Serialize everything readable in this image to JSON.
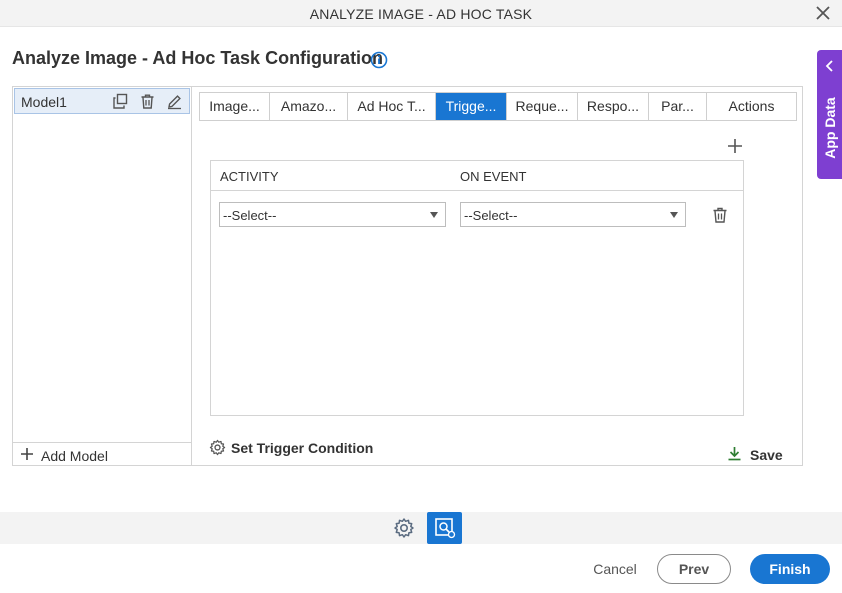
{
  "window": {
    "title": "ANALYZE IMAGE - AD HOC TASK"
  },
  "page": {
    "heading": "Analyze Image - Ad Hoc Task Configuration"
  },
  "side_tab": {
    "label": "App Data"
  },
  "models": {
    "items": [
      {
        "label": "Model1"
      }
    ],
    "add_label": "Add Model"
  },
  "tabs": [
    {
      "label": "Image...",
      "active": false
    },
    {
      "label": "Amazo...",
      "active": false
    },
    {
      "label": "Ad Hoc T...",
      "active": false
    },
    {
      "label": "Trigge...",
      "active": true
    },
    {
      "label": "Reque...",
      "active": false
    },
    {
      "label": "Respo...",
      "active": false
    },
    {
      "label": "Par...",
      "active": false
    },
    {
      "label": "Actions",
      "active": false
    }
  ],
  "grid": {
    "columns": [
      "ACTIVITY",
      "ON EVENT"
    ],
    "rows": [
      {
        "activity": "--Select--",
        "on_event": "--Select--"
      }
    ]
  },
  "actions": {
    "set_trigger_condition": "Set Trigger Condition",
    "save": "Save"
  },
  "footer": {
    "cancel": "Cancel",
    "prev": "Prev",
    "finish": "Finish"
  },
  "colors": {
    "accent": "#1976d2",
    "app_data_tab": "#7e3fd1",
    "save_icon": "#2e7d32"
  }
}
